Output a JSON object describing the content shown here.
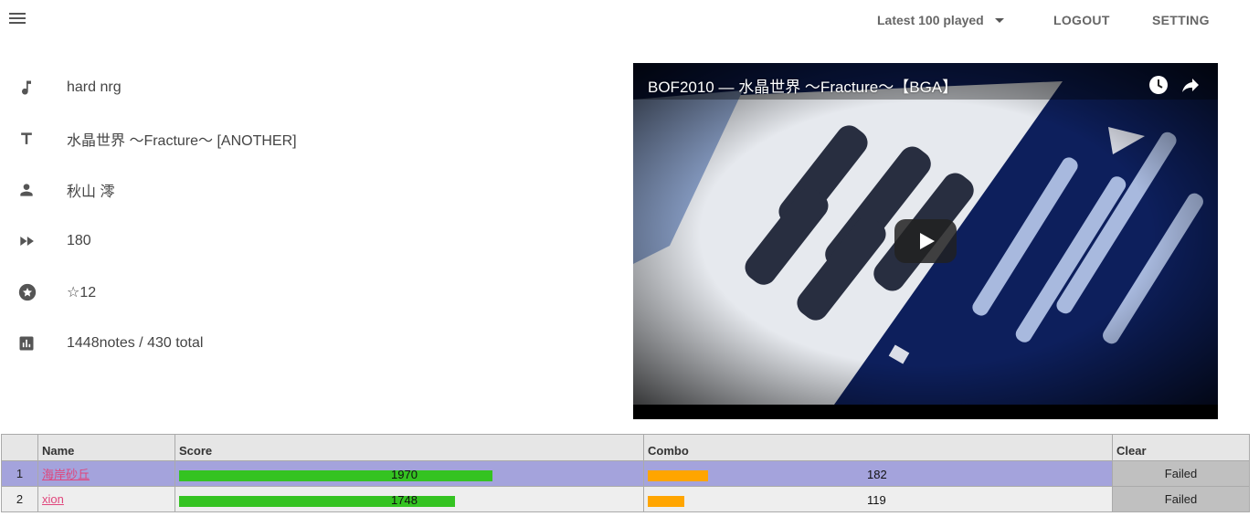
{
  "header": {
    "menu_icon": "hamburger-menu-icon",
    "sort_label": "Latest 100 played",
    "logout_label": "LOGOUT",
    "setting_label": "SETTING"
  },
  "song": {
    "genre": "hard nrg",
    "title": "水晶世界 〜Fracture〜 [ANOTHER]",
    "artist": "秋山 澪",
    "bpm": "180",
    "level": "☆12",
    "notes": "1448notes / 430 total"
  },
  "video": {
    "title": "BOF2010 — 水晶世界 〜Fracture〜【BGA】"
  },
  "table": {
    "headers": [
      "",
      "Name",
      "Score",
      "Combo",
      "Clear"
    ],
    "rows": [
      {
        "rank": "1",
        "name": "海岸砂丘",
        "score": "1970",
        "combo": "182",
        "clear": "Failed"
      },
      {
        "rank": "2",
        "name": "xion",
        "score": "1748",
        "combo": "119",
        "clear": "Failed"
      }
    ]
  },
  "colors": {
    "score_bar": "#34c321",
    "combo_bar": "#ffa500",
    "row_highlight": "#a4a3dc",
    "clear_failed": "#c0c0c0"
  }
}
